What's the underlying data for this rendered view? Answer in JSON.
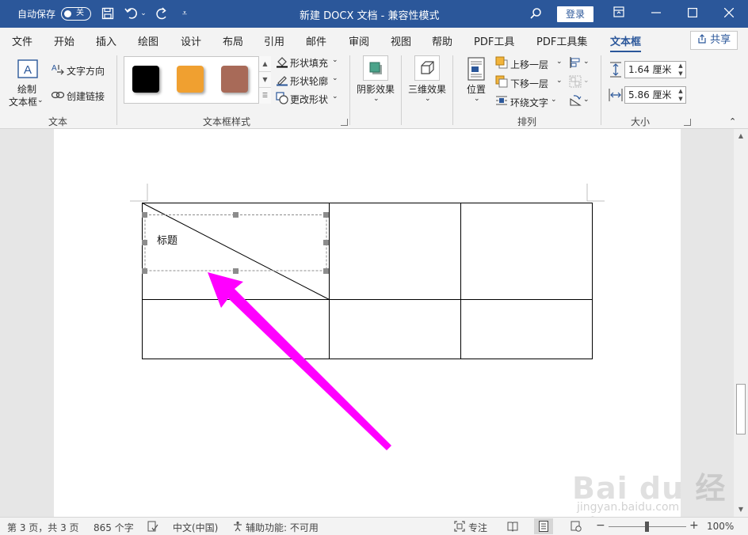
{
  "titlebar": {
    "autosave_label": "自动保存",
    "autosave_state": "关",
    "document_title": "新建 DOCX 文档  -  兼容性模式",
    "login_label": "登录"
  },
  "tabs": [
    {
      "label": "文件"
    },
    {
      "label": "开始"
    },
    {
      "label": "插入"
    },
    {
      "label": "绘图"
    },
    {
      "label": "设计"
    },
    {
      "label": "布局"
    },
    {
      "label": "引用"
    },
    {
      "label": "邮件"
    },
    {
      "label": "审阅"
    },
    {
      "label": "视图"
    },
    {
      "label": "帮助"
    },
    {
      "label": "PDF工具"
    },
    {
      "label": "PDF工具集"
    },
    {
      "label": "文本框"
    }
  ],
  "share_label": "共享",
  "ribbon": {
    "text_group": {
      "label": "文本",
      "draw_textbox_l1": "绘制",
      "draw_textbox_l2": "文本框",
      "text_direction": "文字方向",
      "create_link": "创建链接"
    },
    "styles_group": {
      "label": "文本框样式",
      "swatches": [
        "#000000",
        "#f0a030",
        "#a86a58"
      ],
      "shape_fill": "形状填充",
      "shape_outline": "形状轮廓",
      "change_shape": "更改形状"
    },
    "shadow_group": {
      "shadow_effects": "阴影效果"
    },
    "threed_group": {
      "threed_effects": "三维效果"
    },
    "arrange_group": {
      "label": "排列",
      "position": "位置",
      "bring_forward": "上移一层",
      "send_backward": "下移一层",
      "wrap_text": "环绕文字"
    },
    "size_group": {
      "label": "大小",
      "height_value": "1.64 厘米",
      "width_value": "5.86 厘米"
    }
  },
  "document": {
    "textbox_text": "标题"
  },
  "statusbar": {
    "page_info": "第 3 页，共 3 页",
    "word_count": "865 个字",
    "language": "中文(中国)",
    "accessibility": "辅助功能: 不可用",
    "focus": "专注",
    "zoom": "100%",
    "zoom_minus": "−",
    "zoom_plus": "+"
  },
  "watermark": {
    "brand": "Bai du 经验",
    "url": "jingyan.baidu.com"
  }
}
